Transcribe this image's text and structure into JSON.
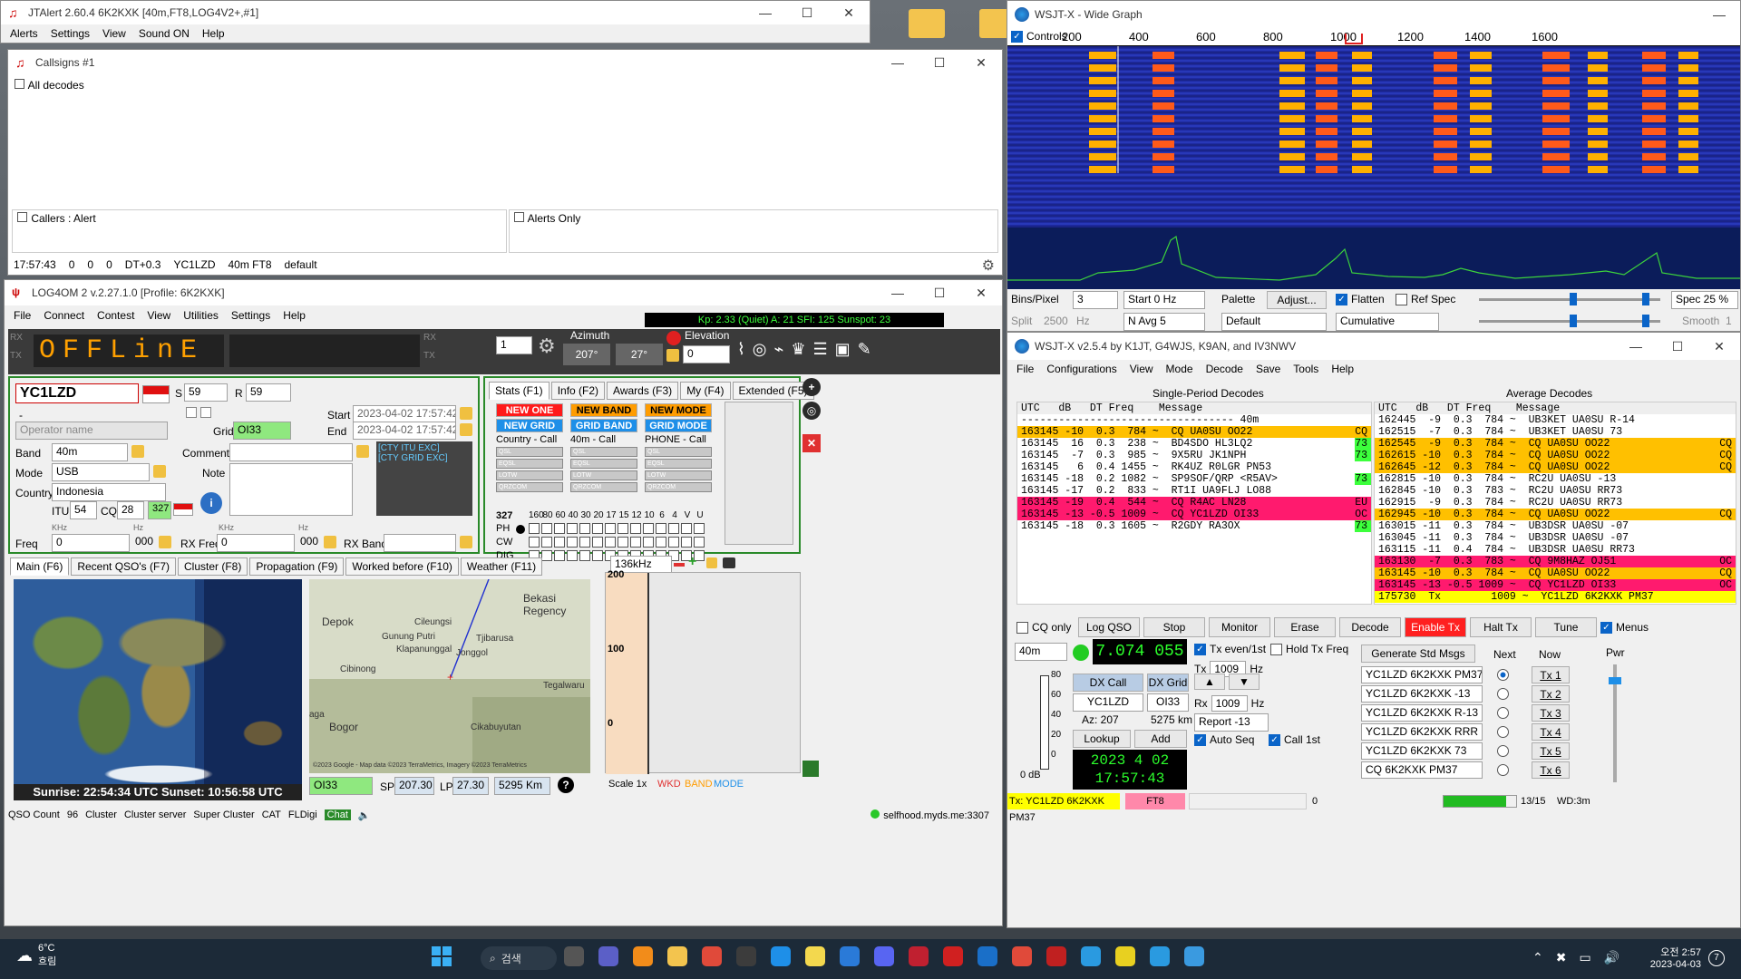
{
  "desktop": {
    "bg": "#5a5f64"
  },
  "jtalert": {
    "title": "JTAlert 2.60.4 6K2KXK [40m,FT8,LOG4V2+,#1]",
    "menus": [
      "Alerts",
      "Settings",
      "View",
      "Sound ON",
      "Help"
    ]
  },
  "callsigns": {
    "title": "Callsigns #1",
    "all_decodes": "All decodes",
    "callers": "Callers : Alert",
    "alerts_only": "Alerts Only",
    "status": [
      "17:57:43",
      "0",
      "0",
      "0",
      "DT+0.3",
      "YC1LZD",
      "40m FT8",
      "default"
    ]
  },
  "log4om": {
    "title": "LOG4OM 2 v.2.27.1.0 [Profile: 6K2KXK]",
    "menus": [
      "File",
      "Connect",
      "Contest",
      "View",
      "Utilities",
      "Settings",
      "Help"
    ],
    "propagation": "Kp: 2.33 (Quiet)  A: 21  SFI: 125 Sunspot: 23",
    "offline": "OFFLinE",
    "rx": "RX",
    "tx": "TX",
    "step": "1",
    "azimuth_label": "Azimuth",
    "azimuth": "207°",
    "azimuth2": "27°",
    "elevation_label": "Elevation",
    "elevation": "0",
    "callsign": "YC1LZD",
    "s_label": "S",
    "s_value": "59",
    "r_label": "R",
    "r_value": "59",
    "dash": "-",
    "operator_placeholder": "Operator name",
    "grid_label": "Grid",
    "grid": "OI33",
    "start_label": "Start",
    "start": "2023-04-02 17:57:42",
    "end_label": "End",
    "end": "2023-04-02 17:57:42",
    "band_label": "Band",
    "band": "40m",
    "mode_label": "Mode",
    "mode": "USB",
    "country_label": "Country",
    "country": "Indonesia",
    "comment_label": "Comment",
    "note_label": "Note",
    "cty1": "[CTY ITU EXC]",
    "cty2": "[CTY GRID EXC]",
    "itu_label": "ITU",
    "itu": "54",
    "cq_label": "CQ",
    "cq": "28",
    "dxcc": "327",
    "khz": "KHz",
    "hz": "Hz",
    "freq_label": "Freq",
    "freq": "0",
    "freq_hz": "000",
    "rxfreq_label": "RX Freq",
    "rxfreq": "0",
    "rxfreq_hz": "000",
    "rxband_label": "RX Band",
    "stat_tabs": [
      "Stats (F1)",
      "Info (F2)",
      "Awards (F3)",
      "My (F4)",
      "Extended (F5)"
    ],
    "new_one": "NEW ONE",
    "new_band": "NEW BAND",
    "new_mode": "NEW MODE",
    "new_grid": "NEW GRID",
    "grid_band": "GRID BAND",
    "grid_mode": "GRID MODE",
    "col1": "Country - Call",
    "col2": "40m - Call",
    "col3": "PHONE - Call",
    "conf": [
      "QSL",
      "EQSL",
      "LOTW",
      "QRZCOM"
    ],
    "count": "327",
    "bands": [
      "160",
      "80",
      "60",
      "40",
      "30",
      "20",
      "17",
      "15",
      "12",
      "10",
      "6",
      "4",
      "V",
      "U"
    ],
    "modes": [
      "PH",
      "CW",
      "DIG"
    ],
    "main_tabs": [
      "Main (F6)",
      "Recent QSO's (F7)",
      "Cluster (F8)",
      "Propagation (F9)",
      "Worked before (F10)",
      "Weather (F11)"
    ],
    "sun": "Sunrise: 22:54:34 UTC  Sunset: 10:56:58 UTC",
    "map_places": [
      "Depok",
      "Bekasi Regency",
      "Cileungsi",
      "Gunung Putri",
      "Klapanunggal",
      "Tjibarusa",
      "Jonggol",
      "Cibinong",
      "Bogor",
      "Cikabuyutan",
      "Tegalwaru",
      "aga"
    ],
    "map_credit": "©2023 Google - Map data ©2023 TerraMetrics, Imagery ©2023 TerraMetrics",
    "grid_bottom": "OI33",
    "sp_label": "SP",
    "sp": "207.30",
    "lp_label": "LP",
    "lp": "27.30",
    "distance": "5295 Km",
    "scope_freq": "136kHz",
    "scale_ticks": [
      "200",
      "100",
      "0"
    ],
    "scale_label": "Scale 1x",
    "wkd": "WKD",
    "band_leg": "BAND",
    "mode_leg": "MODE",
    "statusbar": [
      "QSO Count",
      "96",
      "Cluster",
      "Cluster server",
      "Super Cluster",
      "CAT",
      "FLDigi",
      "Chat"
    ],
    "server": "selfhood.myds.me:3307"
  },
  "widegraph": {
    "title": "WSJT-X - Wide Graph",
    "controls": "Controls",
    "ticks": [
      "200",
      "400",
      "600",
      "800",
      "1000",
      "1200",
      "1400",
      "1600"
    ],
    "bins_label": "Bins/Pixel",
    "bins": "3",
    "start": "Start 0 Hz",
    "palette": "Palette",
    "adjust": "Adjust...",
    "flatten": "Flatten",
    "refspec": "Ref Spec",
    "spec": "Spec 25 %",
    "split": "Split",
    "split_val": "2500",
    "split_unit": "Hz",
    "navg": "N Avg 5",
    "default": "Default",
    "cumulative": "Cumulative",
    "smooth": "Smooth",
    "smooth_val": "1"
  },
  "wsjtx": {
    "title": "WSJT-X   v2.5.4   by K1JT, G4WJS, K9AN, and IV3NWV",
    "menus": [
      "File",
      "Configurations",
      "View",
      "Mode",
      "Decode",
      "Save",
      "Tools",
      "Help"
    ],
    "single_title": "Single-Period Decodes",
    "average_title": "Average Decodes",
    "header": "UTC   dB   DT Freq    Message",
    "sep": "---------------------------------- 40m",
    "left": [
      {
        "t": "163145 -10  0.3  784 ~  CQ UA0SU OO22",
        "tag": "CQ",
        "bg": "#ffc000"
      },
      {
        "t": "163145  16  0.3  238 ~  BD4SDO HL3LQ2",
        "tag": "73",
        "bg": ""
      },
      {
        "t": "163145  -7  0.3  985 ~  9X5RU JK1NPH",
        "tag": "73",
        "bg": ""
      },
      {
        "t": "163145   6  0.4 1455 ~  RK4UZ R0LGR PN53",
        "tag": "",
        "bg": ""
      },
      {
        "t": "163145 -18  0.2 1082 ~  SP9SOF/QRP <R5AV>",
        "tag": "73",
        "bg": ""
      },
      {
        "t": "163145 -17  0.2  833 ~  RT1I UA9FLJ LO88",
        "tag": "",
        "bg": ""
      },
      {
        "t": "163145 -19  0.4  544 ~  CQ R4AC LN28",
        "tag": "EU",
        "bg": "#ff1a6e"
      },
      {
        "t": "163145 -13 -0.5 1009 ~  CQ YC1LZD OI33",
        "tag": "OC",
        "bg": "#ff1a6e"
      },
      {
        "t": "163145 -18  0.3 1605 ~  R2GDY RA3OX",
        "tag": "73",
        "bg": ""
      }
    ],
    "right": [
      {
        "t": "162445  -9  0.3  784 ~  UB3KET UA0SU R-14",
        "tag": "",
        "bg": ""
      },
      {
        "t": "162515  -7  0.3  784 ~  UB3KET UA0SU 73",
        "tag": "",
        "bg": ""
      },
      {
        "t": "162545  -9  0.3  784 ~  CQ UA0SU OO22",
        "tag": "CQ",
        "bg": "#ffc000"
      },
      {
        "t": "162615 -10  0.3  784 ~  CQ UA0SU OO22",
        "tag": "CQ",
        "bg": "#ffc000"
      },
      {
        "t": "162645 -12  0.3  784 ~  CQ UA0SU OO22",
        "tag": "CQ",
        "bg": "#ffc000"
      },
      {
        "t": "162815 -10  0.3  784 ~  RC2U UA0SU -13",
        "tag": "",
        "bg": ""
      },
      {
        "t": "162845 -10  0.3  783 ~  RC2U UA0SU RR73",
        "tag": "",
        "bg": ""
      },
      {
        "t": "162915  -9  0.3  784 ~  RC2U UA0SU RR73",
        "tag": "",
        "bg": ""
      },
      {
        "t": "162945 -10  0.3  784 ~  CQ UA0SU OO22",
        "tag": "CQ",
        "bg": "#ffc000"
      },
      {
        "t": "163015 -11  0.3  784 ~  UB3DSR UA0SU -07",
        "tag": "",
        "bg": ""
      },
      {
        "t": "163045 -11  0.3  784 ~  UB3DSR UA0SU -07",
        "tag": "",
        "bg": ""
      },
      {
        "t": "163115 -11  0.4  784 ~  UB3DSR UA0SU RR73",
        "tag": "",
        "bg": ""
      },
      {
        "t": "163130  -7  0.3  783 ~  CQ 9M8HAZ OJ51",
        "tag": "OC",
        "bg": "#ff1a6e"
      },
      {
        "t": "163145 -10  0.3  784 ~  CQ UA0SU OO22",
        "tag": "CQ",
        "bg": "#ffc000"
      },
      {
        "t": "163145 -13 -0.5 1009 ~  CQ YC1LZD OI33",
        "tag": "OC",
        "bg": "#ff1a6e"
      },
      {
        "t": "175730  Tx        1009 ~  YC1LZD 6K2KXK PM37",
        "tag": "",
        "bg": "#ffff00"
      }
    ],
    "cq_only": "CQ only",
    "log_qso": "Log QSO",
    "stop": "Stop",
    "monitor": "Monitor",
    "erase": "Erase",
    "decode": "Decode",
    "enable_tx": "Enable Tx",
    "halt_tx": "Halt Tx",
    "tune": "Tune",
    "menus_chk": "Menus",
    "band": "40m",
    "freq": "7.074 055",
    "tx_even": "Tx even/1st",
    "hold_tx": "Hold Tx Freq",
    "tx_label": "Tx",
    "tx_hz": "1009",
    "hz": "Hz",
    "rx_label": "Rx",
    "rx_hz": "1009",
    "report": "Report -13",
    "auto_seq": "Auto Seq",
    "call_1st": "Call 1st",
    "dx_call_label": "DX Call",
    "dx_grid_label": "DX Grid",
    "dx_call": "YC1LZD",
    "dx_grid": "OI33",
    "az": "Az: 207",
    "km": "5275 km",
    "lookup": "Lookup",
    "add": "Add",
    "date": "2023 4 02",
    "time": "17:57:43",
    "meter": [
      "80",
      "60",
      "40",
      "20",
      "0"
    ],
    "db": "0 dB",
    "gen": "Generate Std Msgs",
    "next": "Next",
    "now": "Now",
    "pwr": "Pwr",
    "msgs": [
      "YC1LZD 6K2KXK PM37",
      "YC1LZD 6K2KXK -13",
      "YC1LZD 6K2KXK R-13",
      "YC1LZD 6K2KXK RRR",
      "YC1LZD 6K2KXK 73",
      "CQ 6K2KXK PM37"
    ],
    "txbtns": [
      "Tx 1",
      "Tx 2",
      "Tx 3",
      "Tx 4",
      "Tx 5",
      "Tx 6"
    ],
    "status_tx": "Tx: YC1LZD 6K2KXK PM37",
    "status_mode": "FT8",
    "status_zero": "0",
    "status_period": "13/15",
    "status_wd": "WD:3m"
  },
  "taskbar": {
    "temp": "6°C",
    "weather": "흐림",
    "search": "검색",
    "ampm": "오전 2:57",
    "date": "2023-04-03",
    "badge": "7"
  }
}
